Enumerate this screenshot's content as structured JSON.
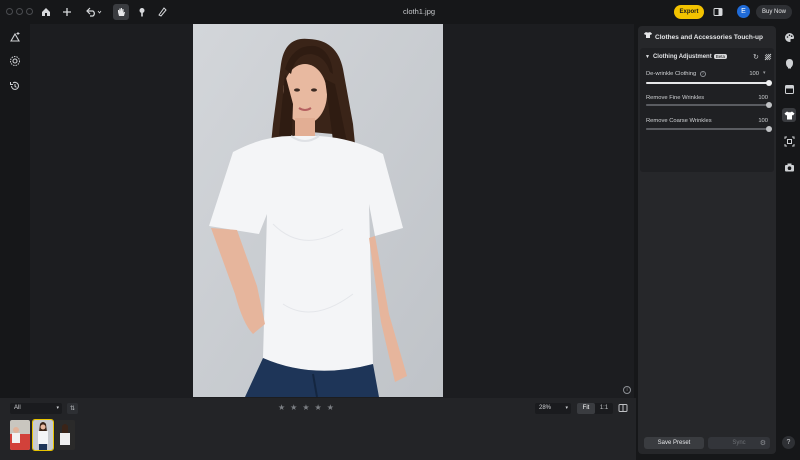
{
  "window": {
    "title": "cloth1.jpg"
  },
  "toolbar": {
    "export_label": "Export",
    "avatar_initial": "E",
    "buy_label": "Buy Now"
  },
  "filmstrip": {
    "filter_value": "All",
    "zoom_value": "28%",
    "fit_label": "Fit",
    "one_to_one_label": "1:1",
    "rating_stars": 5
  },
  "panel": {
    "title": "Clothes and Accessories Touch-up",
    "section_title": "Clothing Adjustment",
    "badge": "Beta",
    "sliders": [
      {
        "label": "De-wrinkle Clothing",
        "value": "100",
        "fraction": 1.0
      },
      {
        "label": "Remove Fine Wrinkles",
        "value": "100",
        "fraction": 1.0
      },
      {
        "label": "Remove Coarse Wrinkles",
        "value": "100",
        "fraction": 1.0
      }
    ],
    "save_preset_label": "Save Preset",
    "sync_label": "Sync"
  },
  "colors": {
    "accent": "#f3c300",
    "avatar": "#1f6bd8",
    "background": "#161719",
    "panel": "#26272a"
  }
}
